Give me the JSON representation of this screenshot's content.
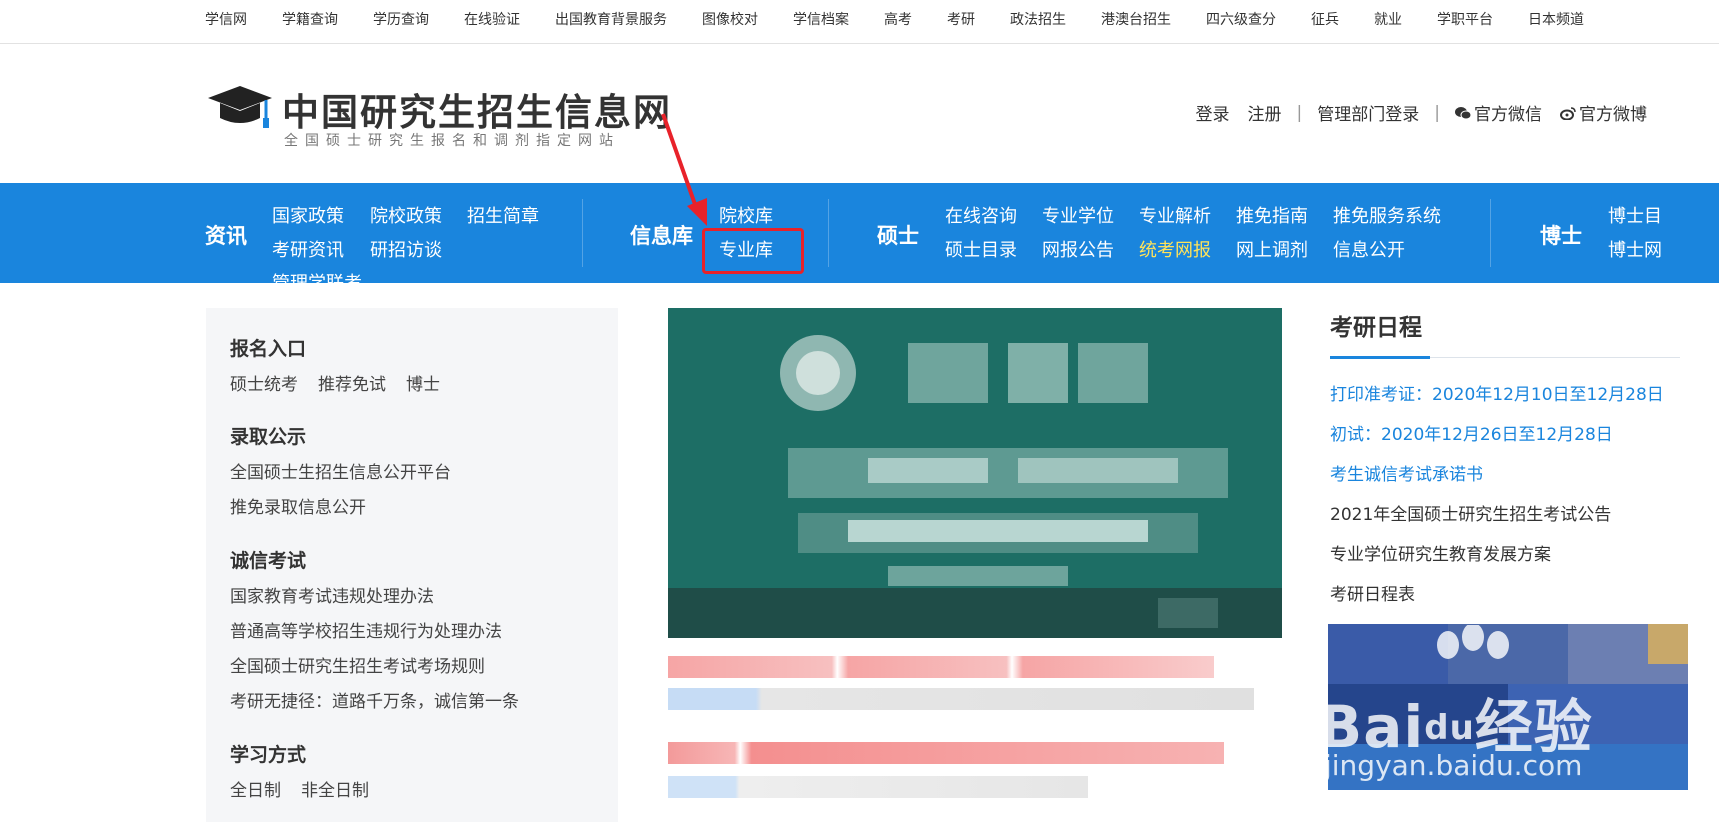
{
  "topbar": {
    "links": [
      "学信网",
      "学籍查询",
      "学历查询",
      "在线验证",
      "出国教育背景服务",
      "图像校对",
      "学信档案",
      "高考",
      "考研",
      "政法招生",
      "港澳台招生",
      "四六级查分",
      "征兵",
      "就业",
      "学职平台",
      "日本频道"
    ]
  },
  "header": {
    "site_title": "中国研究生招生信息网",
    "site_subtitle": "全国硕士研究生报名和调剂指定网站",
    "login": "登录",
    "register": "注册",
    "admin_login": "管理部门登录",
    "wechat": "官方微信",
    "weibo": "官方微博"
  },
  "nav": {
    "news": {
      "label": "资讯",
      "links": [
        "国家政策",
        "院校政策",
        "招生简章",
        "考研资讯",
        "研招访谈",
        "管理学联考"
      ]
    },
    "info": {
      "label": "信息库",
      "links": [
        "院校库",
        "专业库"
      ]
    },
    "master": {
      "label": "硕士",
      "links": [
        "在线咨询",
        "专业学位",
        "专业解析",
        "推免指南",
        "推免服务系统",
        "硕士目录",
        "网报公告",
        "统考网报",
        "网上调剂",
        "信息公开"
      ]
    },
    "phd": {
      "label": "博士",
      "links": [
        "博士目",
        "博士网"
      ]
    }
  },
  "left_panel": {
    "sections": [
      {
        "heading": "报名入口",
        "links": [
          "硕士统考",
          "推荐免试",
          "博士"
        ]
      },
      {
        "heading": "录取公示",
        "links": [
          "全国硕士生招生信息公开平台",
          "推免录取信息公开"
        ]
      },
      {
        "heading": "诚信考试",
        "links": [
          "国家教育考试违规处理办法",
          "普通高等学校招生违规行为处理办法",
          "全国硕士研究生招生考试考场规则",
          "考研无捷径：道路千万条，诚信第一条"
        ]
      },
      {
        "heading": "学习方式",
        "links": [
          "全日制",
          "非全日制"
        ]
      }
    ]
  },
  "right_column": {
    "title": "考研日程",
    "items": [
      {
        "text": "打印准考证：2020年12月10日至12月28日",
        "style": "blue"
      },
      {
        "text": "初试：2020年12月26日至12月28日",
        "style": "blue"
      },
      {
        "text": "考生诚信考试承诺书",
        "style": "blue"
      },
      {
        "text": "2021年全国硕士研究生招生考试公告",
        "style": "dark"
      },
      {
        "text": "专业学位研究生教育发展方案",
        "style": "dark"
      },
      {
        "text": "考研日程表",
        "style": "dark"
      }
    ]
  },
  "watermark": {
    "brand": "Bai",
    "brand_suffix": "经验",
    "url": "jingyan.baidu.com"
  },
  "colors": {
    "nav_blue": "#1a85dd",
    "highlight_red": "#e8222a",
    "nav_highlight_yellow": "#ffe35a",
    "banner_teal": "#1d6e65"
  }
}
